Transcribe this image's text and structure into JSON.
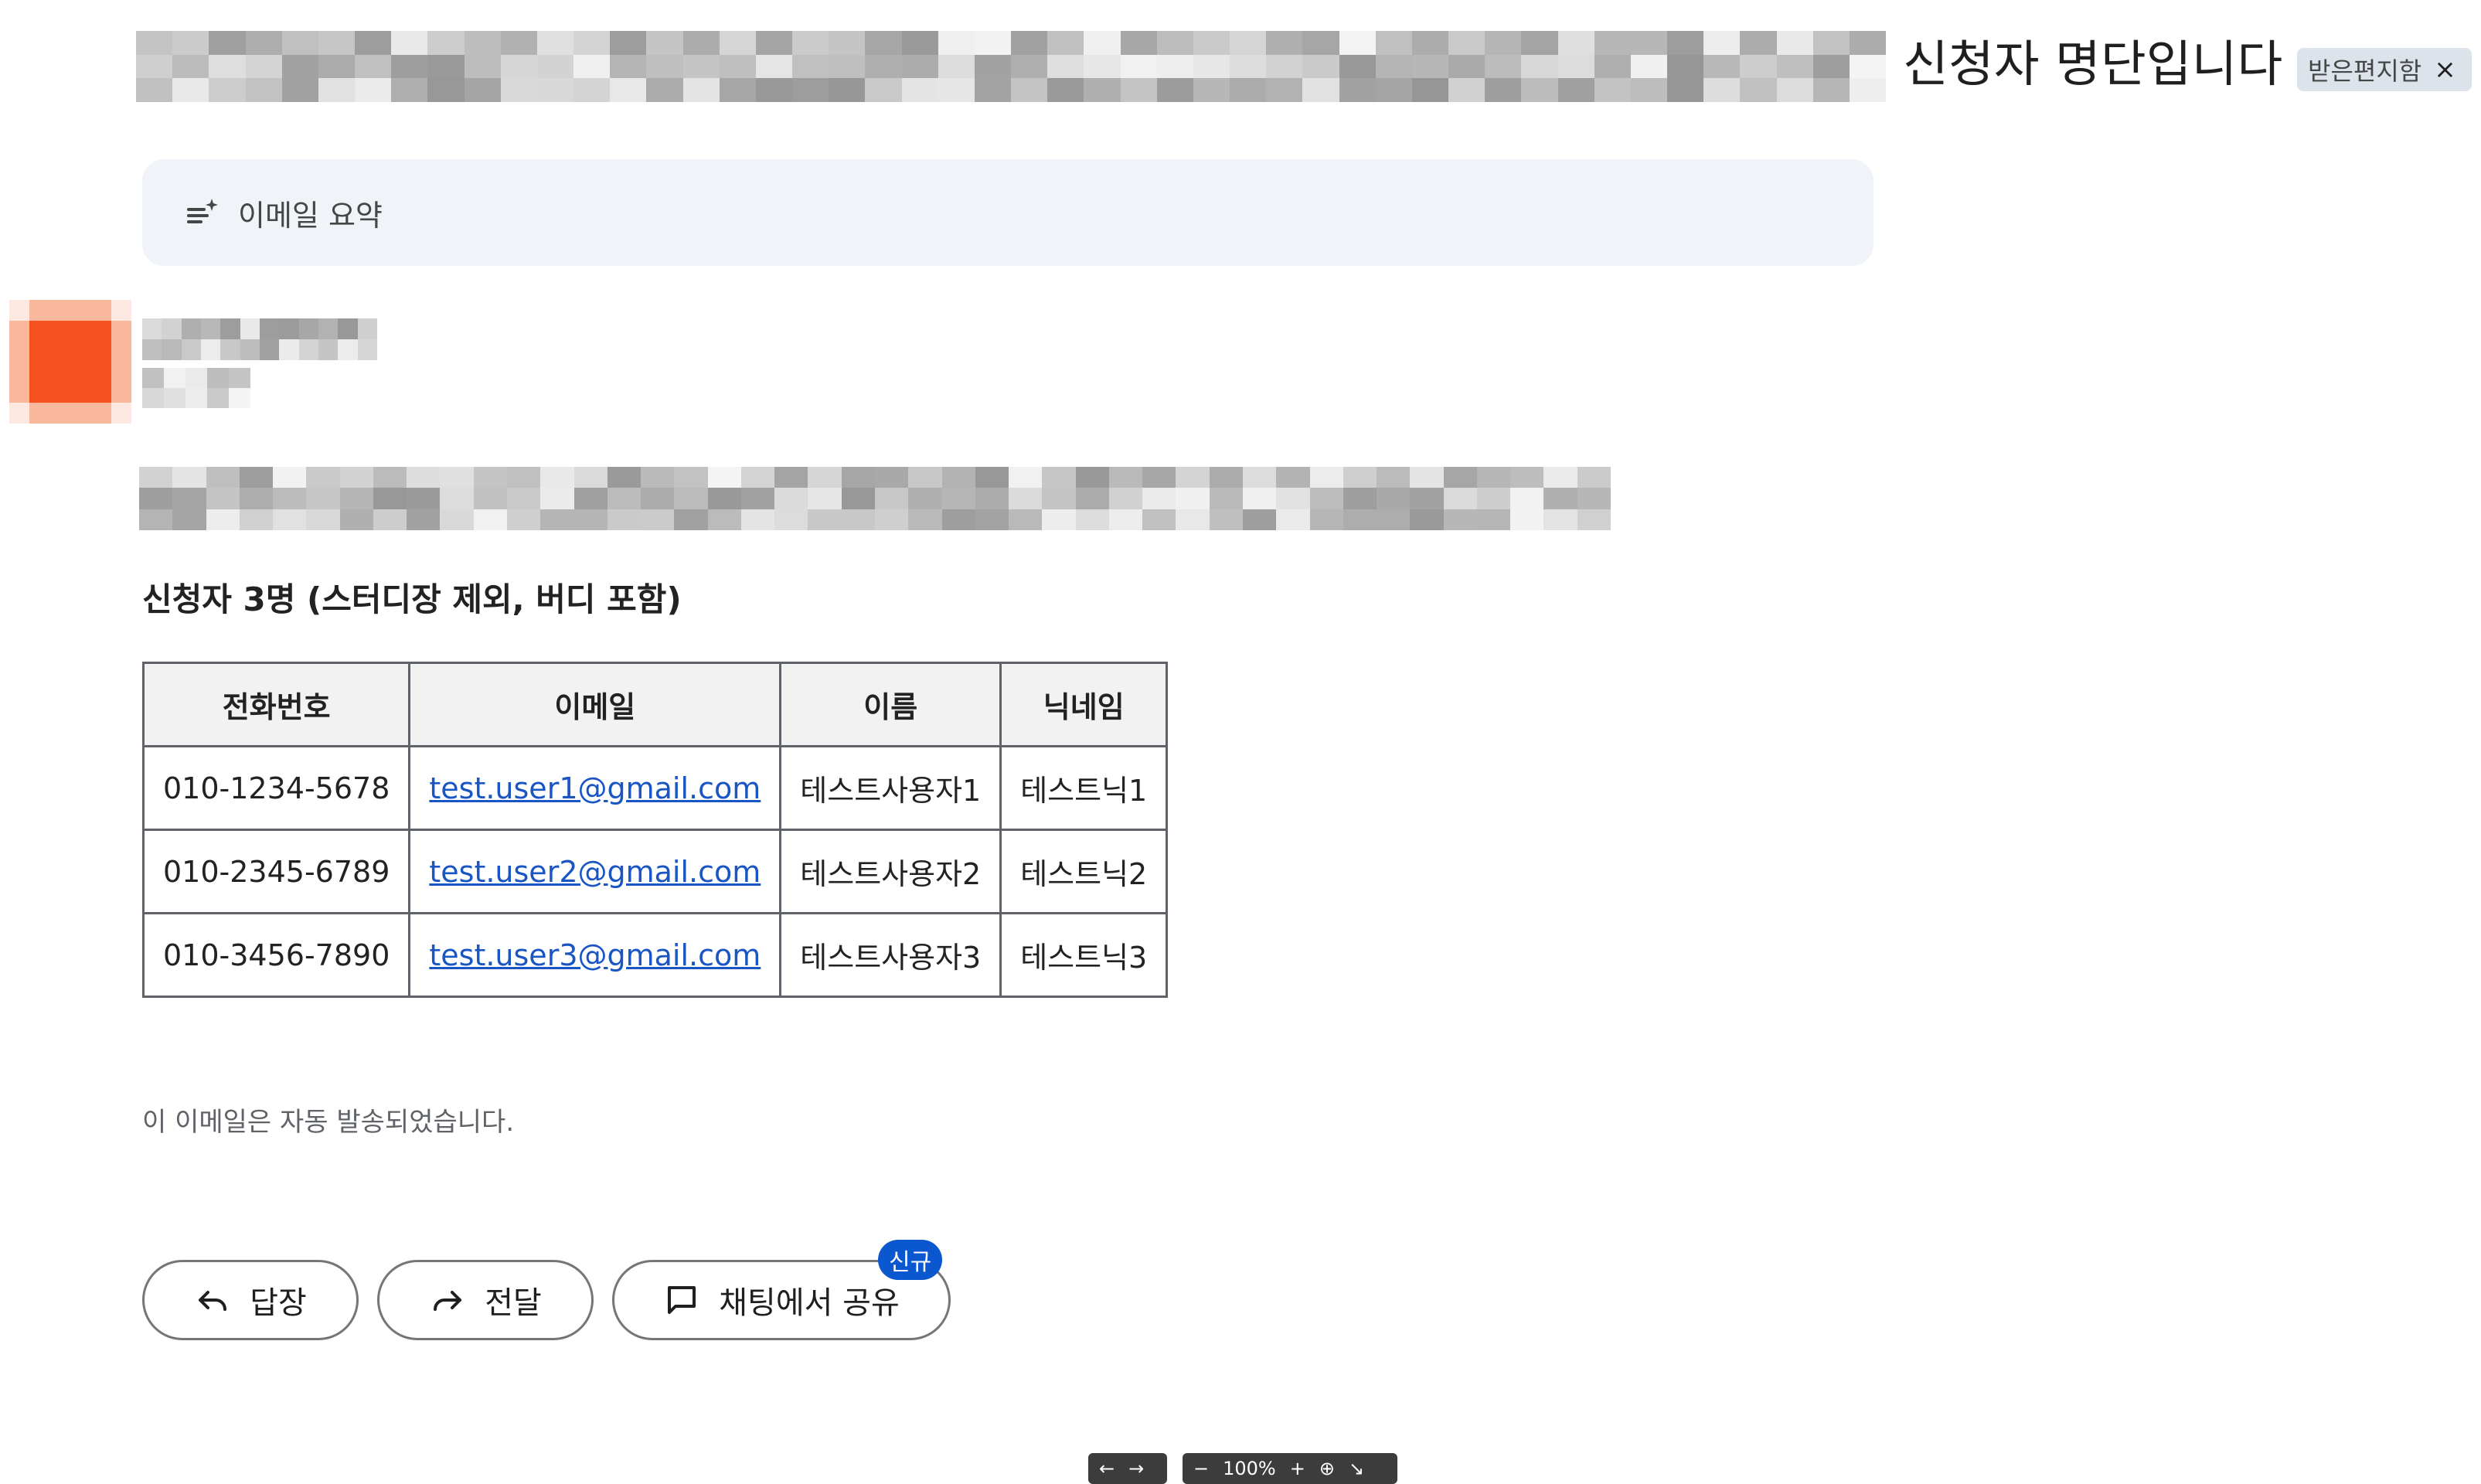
{
  "header": {
    "subject_visible": "신청자 명단입니다",
    "label_chip": "받은편지함",
    "label_close": "×"
  },
  "summary": {
    "label": "이메일 요약",
    "icon": "summarize-sparkle-icon"
  },
  "body": {
    "headline": "신청자 3명 (스터디장 제외, 버디 포함)",
    "table": {
      "headers": [
        "전화번호",
        "이메일",
        "이름",
        "닉네임"
      ],
      "rows": [
        {
          "phone": "010-1234-5678",
          "email": "test.user1@gmail.com",
          "name": "테스트사용자1",
          "nick": "테스트닉1"
        },
        {
          "phone": "010-2345-6789",
          "email": "test.user2@gmail.com",
          "name": "테스트사용자2",
          "nick": "테스트닉2"
        },
        {
          "phone": "010-3456-7890",
          "email": "test.user3@gmail.com",
          "name": "테스트사용자3",
          "nick": "테스트닉3"
        }
      ]
    },
    "auto_note": "이 이메일은 자동 발송되었습니다."
  },
  "actions": {
    "reply": "답장",
    "forward": "전달",
    "share_chat": "채팅에서 공유",
    "new_badge": "신규"
  },
  "viewer_toolbar": {
    "zoom": "100%"
  },
  "colors": {
    "link": "#1a55c4",
    "badge": "#0b57d0",
    "summary_bg": "#f0f4f9",
    "avatar": "#f4511e"
  }
}
